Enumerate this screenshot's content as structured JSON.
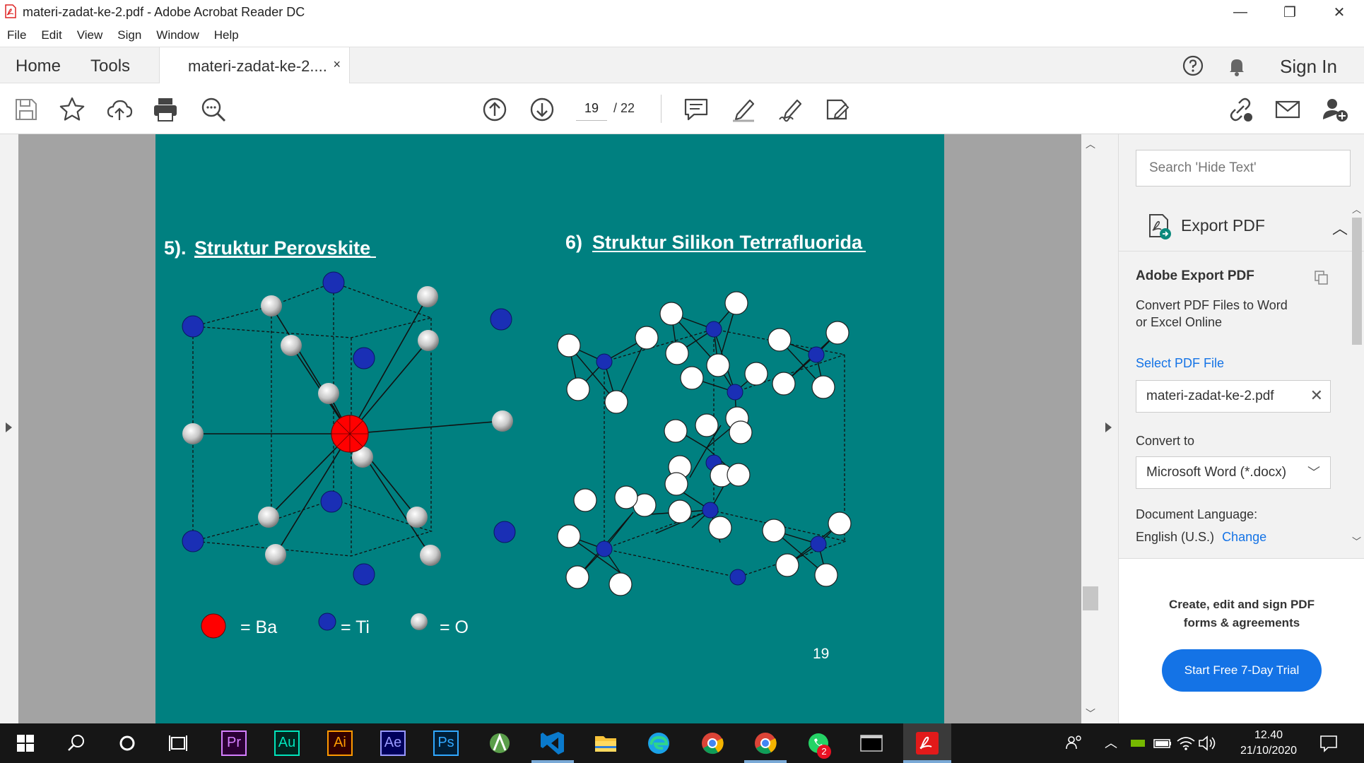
{
  "window": {
    "title": "materi-zadat-ke-2.pdf - Adobe Acrobat Reader DC",
    "minimize": "—",
    "maximize": "❐",
    "close": "✕"
  },
  "menu": [
    "File",
    "Edit",
    "View",
    "Sign",
    "Window",
    "Help"
  ],
  "tabs": {
    "home": "Home",
    "tools": "Tools",
    "document": "materi-zadat-ke-2....",
    "close": "×",
    "sign_in": "Sign In"
  },
  "toolbar": {
    "current_page": "19",
    "total_pages": "/ 22"
  },
  "slide": {
    "left_number": "5).",
    "left_title": "Struktur Perovskite",
    "right_number": "6)",
    "right_title": "Struktur Silikon Tetrrafluorida",
    "legend": [
      "= Ba",
      "= Ti",
      "= O"
    ],
    "legend_colors": [
      "#ff0000",
      "#1a2fb5",
      "#c8c8c8"
    ],
    "page_number": "19",
    "background": "#008080"
  },
  "right_pane": {
    "search_placeholder": "Search 'Hide Text'",
    "export_header": "Export PDF",
    "export_title": "Adobe Export PDF",
    "export_desc_1": "Convert PDF Files to Word",
    "export_desc_2": "or Excel Online",
    "select_file": "Select PDF File",
    "file_name": "materi-zadat-ke-2.pdf",
    "convert_to": "Convert to",
    "format": "Microsoft Word (*.docx)",
    "doc_language": "Document Language:",
    "language_value": "English (U.S.)",
    "change": "Change",
    "promo_1": "Create, edit and sign PDF",
    "promo_2": "forms & agreements",
    "trial_button": "Start Free 7-Day Trial"
  },
  "taskbar": {
    "apps": [
      "Pr",
      "Au",
      "Ai",
      "Ae",
      "Ps"
    ],
    "app_colors": [
      "#d580ff",
      "#00e4bb",
      "#ff9a00",
      "#9999ff",
      "#31a8ff"
    ],
    "whatsapp_badge": "2",
    "time": "12.40",
    "date": "21/10/2020"
  }
}
